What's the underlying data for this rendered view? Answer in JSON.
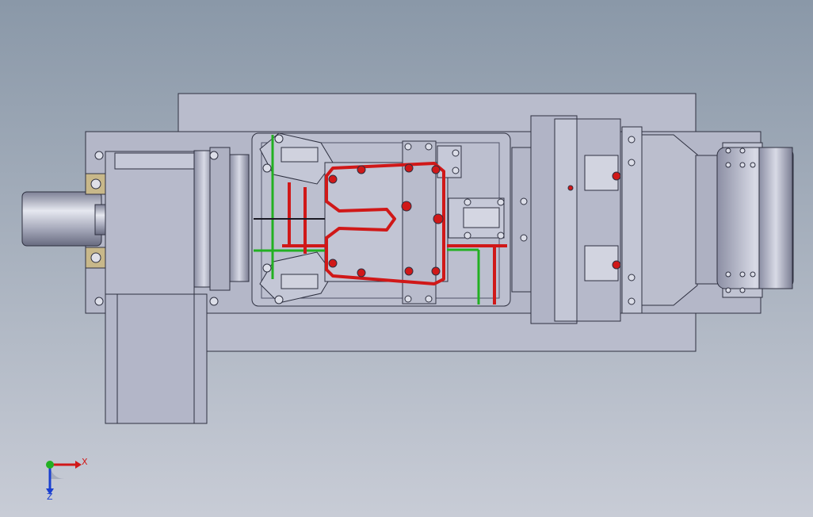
{
  "viewport": {
    "background_top": "#8a98a8",
    "background_bottom": "#c8ccd6"
  },
  "model": {
    "body_color": "#b9bccc",
    "edge_color": "#2e3040",
    "highlight_red": "#d01818",
    "highlight_green": "#22b022"
  },
  "triad": {
    "x_label": "X",
    "z_label": "Z",
    "x_color": "#d01818",
    "y_color": "#22b022",
    "z_color": "#1a3fd0"
  }
}
